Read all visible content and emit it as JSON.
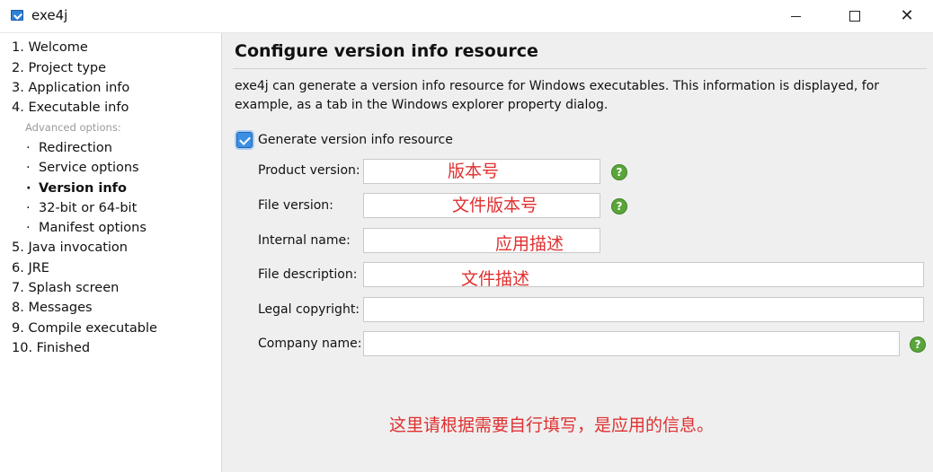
{
  "window": {
    "title": "exe4j",
    "minimize": "minimize",
    "maximize": "maximize",
    "close": "✕"
  },
  "sidebar": {
    "steps": [
      {
        "label": "1. Welcome"
      },
      {
        "label": "2. Project type"
      },
      {
        "label": "3. Application info"
      },
      {
        "label": "4. Executable info"
      },
      {
        "label": "5. Java invocation"
      },
      {
        "label": "6. JRE"
      },
      {
        "label": "7. Splash screen"
      },
      {
        "label": "8. Messages"
      },
      {
        "label": "9. Compile executable"
      },
      {
        "label": "10. Finished"
      }
    ],
    "advanced_label": "Advanced options:",
    "sub_bullet": "·",
    "sub_items": [
      {
        "label": "Redirection",
        "active": false
      },
      {
        "label": "Service options",
        "active": false
      },
      {
        "label": "Version info",
        "active": true
      },
      {
        "label": "32-bit or 64-bit",
        "active": false
      },
      {
        "label": "Manifest options",
        "active": false
      }
    ]
  },
  "main": {
    "title": "Configure version info resource",
    "description": "exe4j can generate a version info resource for Windows executables. This information is displayed, for example, as a tab in the Windows explorer property dialog.",
    "checkbox": {
      "label": "Generate version info resource",
      "checked": true
    },
    "fields": [
      {
        "label": "Product version:",
        "value": "",
        "annotation": "版本号",
        "help": true
      },
      {
        "label": "File version:",
        "value": "",
        "annotation": "文件版本号",
        "help": true
      },
      {
        "label": "Internal name:",
        "value": "",
        "annotation": "应用描述",
        "help": false
      },
      {
        "label": "File description:",
        "value": "",
        "annotation": "文件描述",
        "help": false
      },
      {
        "label": "Legal copyright:",
        "value": "",
        "annotation": "",
        "help": false
      },
      {
        "label": "Company name:",
        "value": "",
        "annotation": "",
        "help": true
      }
    ],
    "help_glyph": "?",
    "bottom_note": "这里请根据需要自行填写，是应用的信息。"
  },
  "colors": {
    "annotation": "#e03030",
    "help": "#5aa53a",
    "checkbox": "#3c8fe3",
    "panel_bg": "#efefef"
  }
}
